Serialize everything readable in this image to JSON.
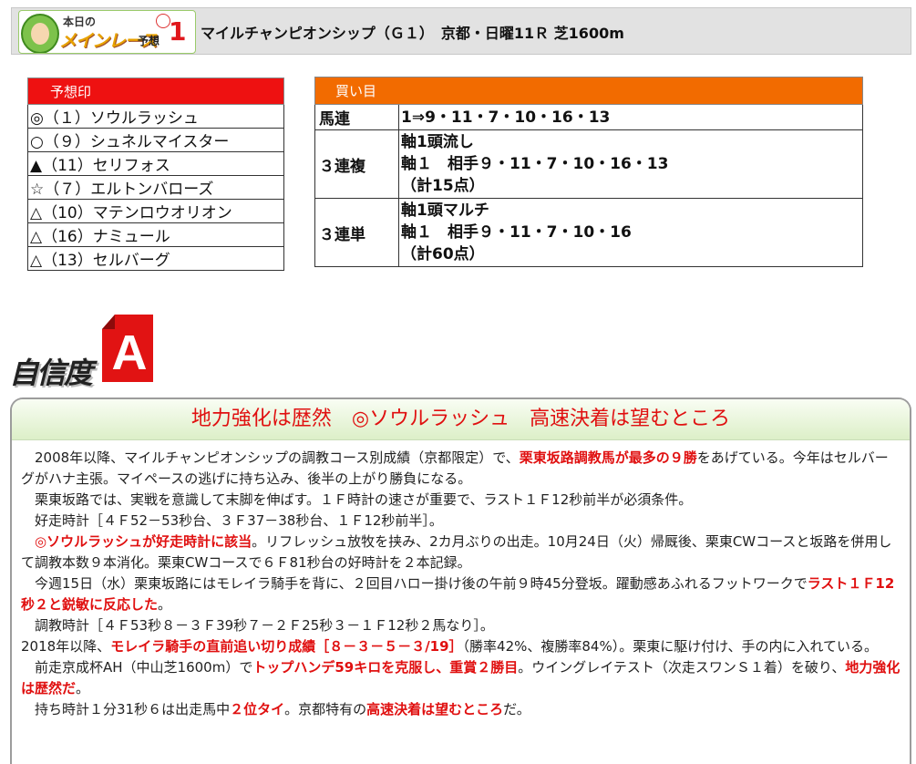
{
  "header": {
    "logo": {
      "top": "本日の",
      "main": "メインレース",
      "yoso": "予想",
      "num": "1"
    },
    "race_title": "マイルチャンピオンシップ（Ｇ１）　京都・日曜11Ｒ 芝1600m"
  },
  "marks": {
    "title": "予想印",
    "rows": [
      "◎（１）ソウルラッシュ",
      "○（９）シュネルマイスター",
      "▲（11）セリフォス",
      "☆（７）エルトンバローズ",
      "△（10）マテンロウオリオン",
      "△（16）ナミュール",
      "△（13）セルバーグ"
    ]
  },
  "bets": {
    "title": "買い目",
    "rows": [
      {
        "type": "馬連",
        "lines": [
          "1⇒9・11・7・10・16・13"
        ]
      },
      {
        "type": "３連複",
        "lines": [
          "軸1頭流し",
          "軸１　相手９・11・7・10・16・13",
          "（計15点）"
        ]
      },
      {
        "type": "３連単",
        "lines": [
          "軸1頭マルチ",
          "軸１　相手９・11・7・10・16",
          "（計60点）"
        ]
      }
    ]
  },
  "confidence": {
    "label": "自信度",
    "grade": "A"
  },
  "commentary": {
    "title": "地力強化は歴然　◎ソウルラッシュ　高速決着は望むところ",
    "p1a": "　2008年以降、マイルチャンピオンシップの調教コース別成績（京都限定）で、",
    "p1b": "栗東坂路調教馬が最多の９勝",
    "p1c": "をあげている。今年はセルバーグがハナ主張。マイペースの逃げに持ち込み、後半の上がり勝負になる。",
    "p2": "　栗東坂路では、実戦を意識して末脚を伸ばす。１Ｆ時計の速さが重要で、ラスト１Ｆ12秒前半が必須条件。",
    "p3": "　好走時計［４Ｆ52－53秒台、３Ｆ37－38秒台、１Ｆ12秒前半］。",
    "p4a": "　",
    "p4b": "◎ソウルラッシュが好走時計に該当",
    "p4c": "。リフレッシュ放牧を挟み、2カ月ぶりの出走。10月24日（火）帰厩後、栗東CWコースと坂路を併用して調教本数９本消化。栗東CWコースで６Ｆ81秒台の好時計を２本記録。",
    "p5a": "　今週15日（水）栗東坂路にはモレイラ騎手を背に、２回目ハロー掛け後の午前９時45分登坂。躍動感あふれるフットワークで",
    "p5b": "ラスト１Ｆ12秒２と鋭敏に反応した",
    "p5c": "。",
    "p6": "　調教時計［４Ｆ53秒８－３Ｆ39秒７－２Ｆ25秒３－１Ｆ12秒２馬なり］。",
    "p7a": "2018年以降、",
    "p7b": "モレイラ騎手の直前追い切り成績［８－３－５－３/19］",
    "p7c": "（勝率42%、複勝率84%）。栗東に駆け付け、手の内に入れている。",
    "p8a": "　前走京成杯AH（中山芝1600m）で",
    "p8b": "トップハンデ59キロを克服し、重賞２勝目",
    "p8c": "。ウイングレイテスト（次走スワンＳ１着）を破り、",
    "p8d": "地力強化は歴然だ",
    "p8e": "。",
    "p9a": "　持ち時計１分31秒６は出走馬中",
    "p9b": "２位タイ",
    "p9c": "。京都特有の",
    "p9d": "高速決着は望むところ",
    "p9e": "だ。"
  }
}
